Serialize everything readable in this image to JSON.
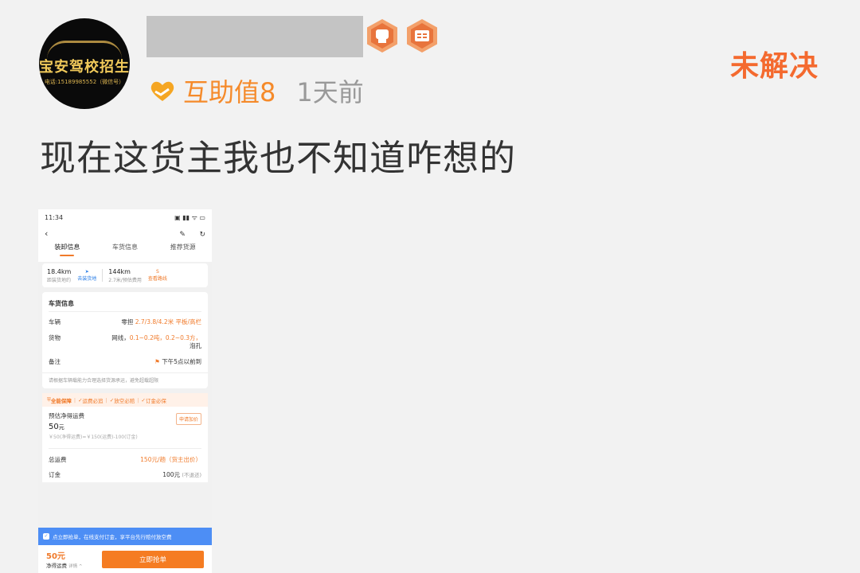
{
  "post": {
    "avatar": {
      "brand": "宝安驾校招生",
      "phone": "电话:15189985552（微信号）"
    },
    "status": "未解决",
    "help_value": "互助值8",
    "time": "1天前",
    "text": "现在这货主我也不知道咋想的"
  },
  "badges": [
    "fist-badge-icon",
    "book-badge-icon"
  ],
  "shot": {
    "statusbar": {
      "time": "11:34",
      "icons": "▣ ▮▮ ᯤ ▭"
    },
    "nav": {
      "back": "‹",
      "edit": "✎",
      "refresh": "↻"
    },
    "tabs": [
      "装卸信息",
      "车货信息",
      "推荐货源"
    ],
    "distance": {
      "d1": "18.4km",
      "d1_sub": "距装货地约",
      "nav_label": "去装货地",
      "d2": "144km",
      "d2_sub": "2.7米/预估费用",
      "route_label": "查看路线"
    },
    "info": {
      "title": "车货信息",
      "vehicle_label": "车辆",
      "vehicle_prefix": "零担",
      "vehicle_value": "2.7/3.8/4.2米 平板/高栏",
      "cargo_label": "货物",
      "cargo_prefix": "网线，",
      "cargo_value": "0.1~0.2吨，0.2~0.3方，",
      "cargo_suffix": "泡孔",
      "remark_label": "备注",
      "remark_value": "下午5点以前到",
      "note": "请根据车辆载能力合理选择货源承运，避免超载超限"
    },
    "guarantee": {
      "brand": "全能保障",
      "items": [
        "运费必追",
        "放空必赔",
        "订金必保"
      ]
    },
    "fee": {
      "label": "预估净得运费",
      "amount": "50",
      "unit": "元",
      "calc": "￥50(净得运费)=￥150(运费)-100(订金)",
      "apply_btn": "申请加价"
    },
    "total": {
      "label": "总运费",
      "value": "150元/趟（货主出价）"
    },
    "deposit": {
      "label": "订金",
      "value": "100元",
      "note": "(不退还)"
    },
    "banner": "点立即抢单，在线支付订金，享平台先行赔付放空费",
    "bottom": {
      "price": "50元",
      "label": "净得运费",
      "detail": "详情 ^",
      "button": "立即抢单"
    }
  }
}
